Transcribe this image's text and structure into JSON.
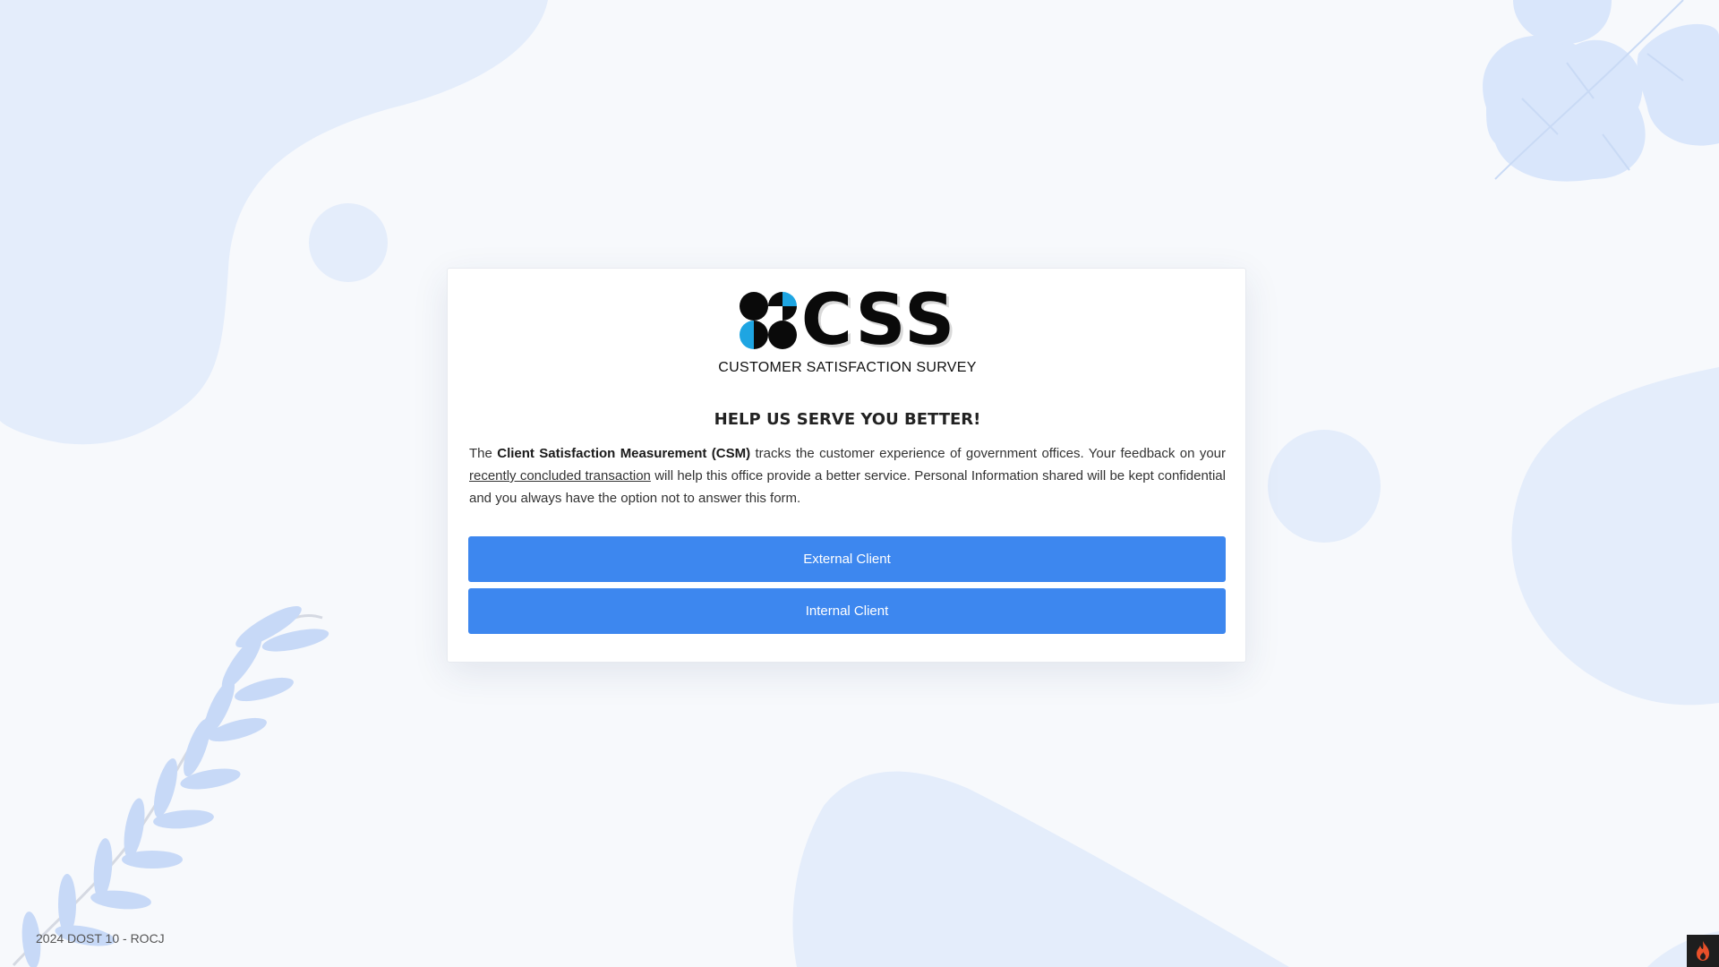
{
  "logo": {
    "wordmark": "CSS",
    "subtitle": "CUSTOMER SATISFACTION SURVEY"
  },
  "card": {
    "heading": "HELP US SERVE YOU BETTER!",
    "intro": {
      "part1": "The ",
      "bold": "Client Satisfaction Measurement (CSM)",
      "part2": " tracks the customer experience of government offices. Your feedback on your ",
      "underline": "recently concluded transaction",
      "part3": " will help this office provide a better service. Personal Information shared will be kept confidential and you always have the option not to answer this form."
    },
    "buttons": {
      "external": "External Client",
      "internal": "Internal Client"
    }
  },
  "footer": {
    "text": "2024 DOST 10 - ROCJ"
  },
  "icons": {
    "logo_mark": "css-logo-mark-icon",
    "corner": "flame-icon"
  },
  "colors": {
    "button": "#3d87ef",
    "logo_accent": "#1ea5e2",
    "background": "#f7f9fc",
    "decor": "#e4edfb"
  }
}
